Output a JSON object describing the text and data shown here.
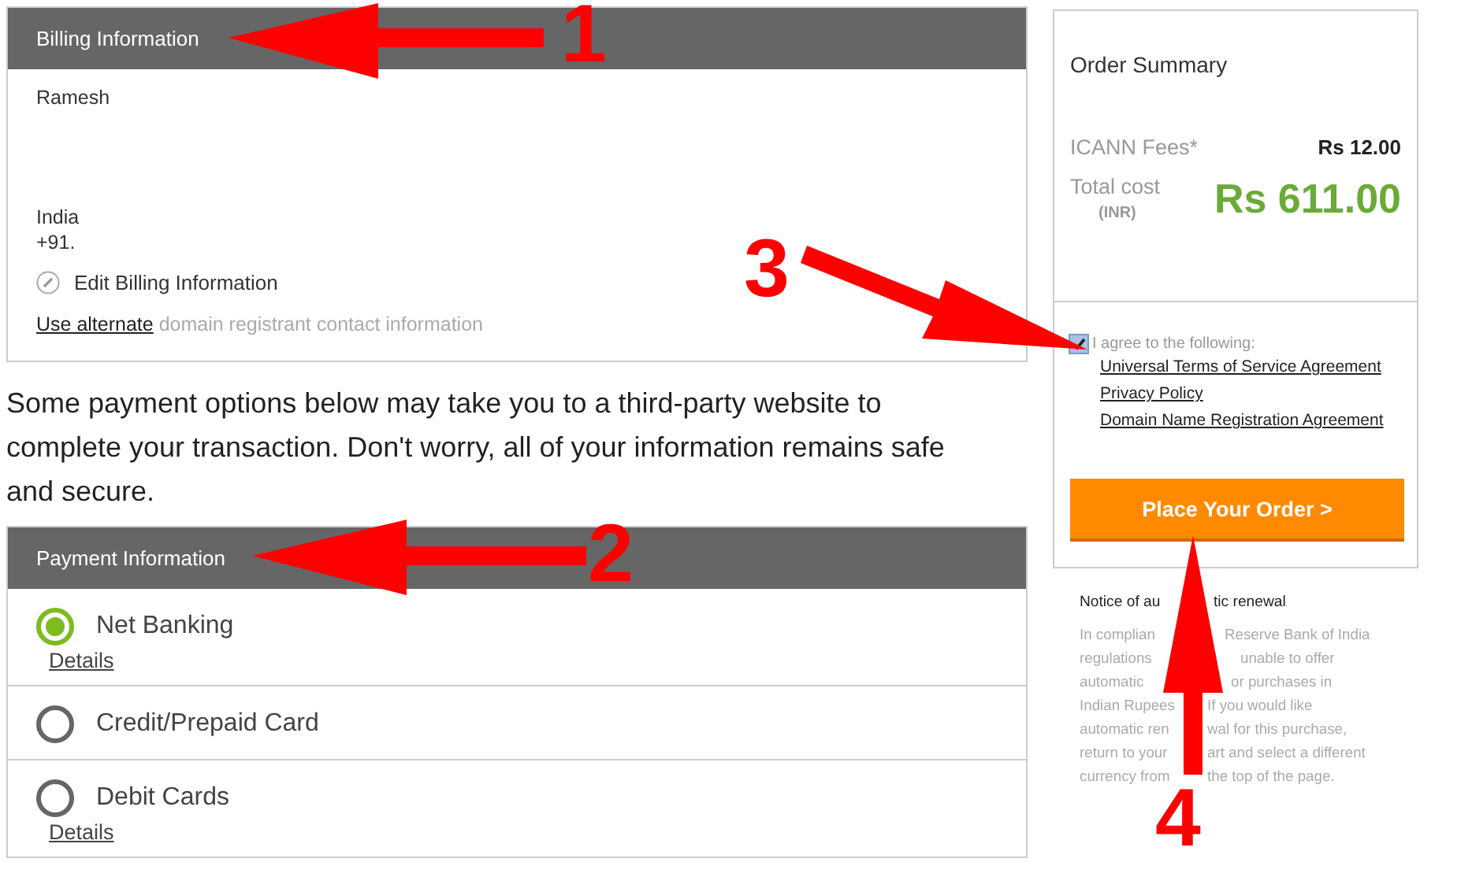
{
  "billing": {
    "title": "Billing Information",
    "name": "Ramesh",
    "country": "India",
    "phone": "+91.",
    "edit_label": "Edit Billing Information",
    "alternate_link": "Use alternate",
    "alternate_rest": "domain registrant contact information"
  },
  "notice_text": "Some payment options below may take you to a third-party website to complete your transaction. Don't worry, all of your information remains safe and secure.",
  "payment": {
    "title": "Payment Information",
    "options": [
      {
        "label": "Net Banking",
        "selected": true,
        "details": "Details"
      },
      {
        "label": "Credit/Prepaid Card",
        "selected": false
      },
      {
        "label": "Debit Cards",
        "selected": false,
        "details": "Details"
      }
    ]
  },
  "order_summary": {
    "title": "Order Summary",
    "fee_label": "ICANN Fees*",
    "fee_value": "Rs 12.00",
    "total_label": "Total cost",
    "total_currency": "(INR)",
    "total_value": "Rs 611.00",
    "agree": {
      "label": "I agree to the following:",
      "checked": true
    },
    "links": [
      "Universal Terms of Service Agreement",
      "Privacy Policy",
      "Domain Name Registration Agreement"
    ],
    "button": "Place Your Order >"
  },
  "renewal": {
    "title_parts": [
      "Notice of au",
      "tic renewal"
    ],
    "lines": [
      [
        "In complian",
        "Reserve Bank of India"
      ],
      [
        "regulations",
        "unable to offer"
      ],
      [
        "automatic",
        "or purchases in"
      ],
      [
        "Indian Rupees",
        "If you would like"
      ],
      [
        "automatic ren",
        "wal for this purchase,"
      ],
      [
        "return to your",
        "art and select a different"
      ],
      [
        "currency from",
        "the top of the page."
      ]
    ]
  },
  "annotations": [
    {
      "number": "1"
    },
    {
      "number": "2"
    },
    {
      "number": "3"
    },
    {
      "number": "4"
    }
  ]
}
